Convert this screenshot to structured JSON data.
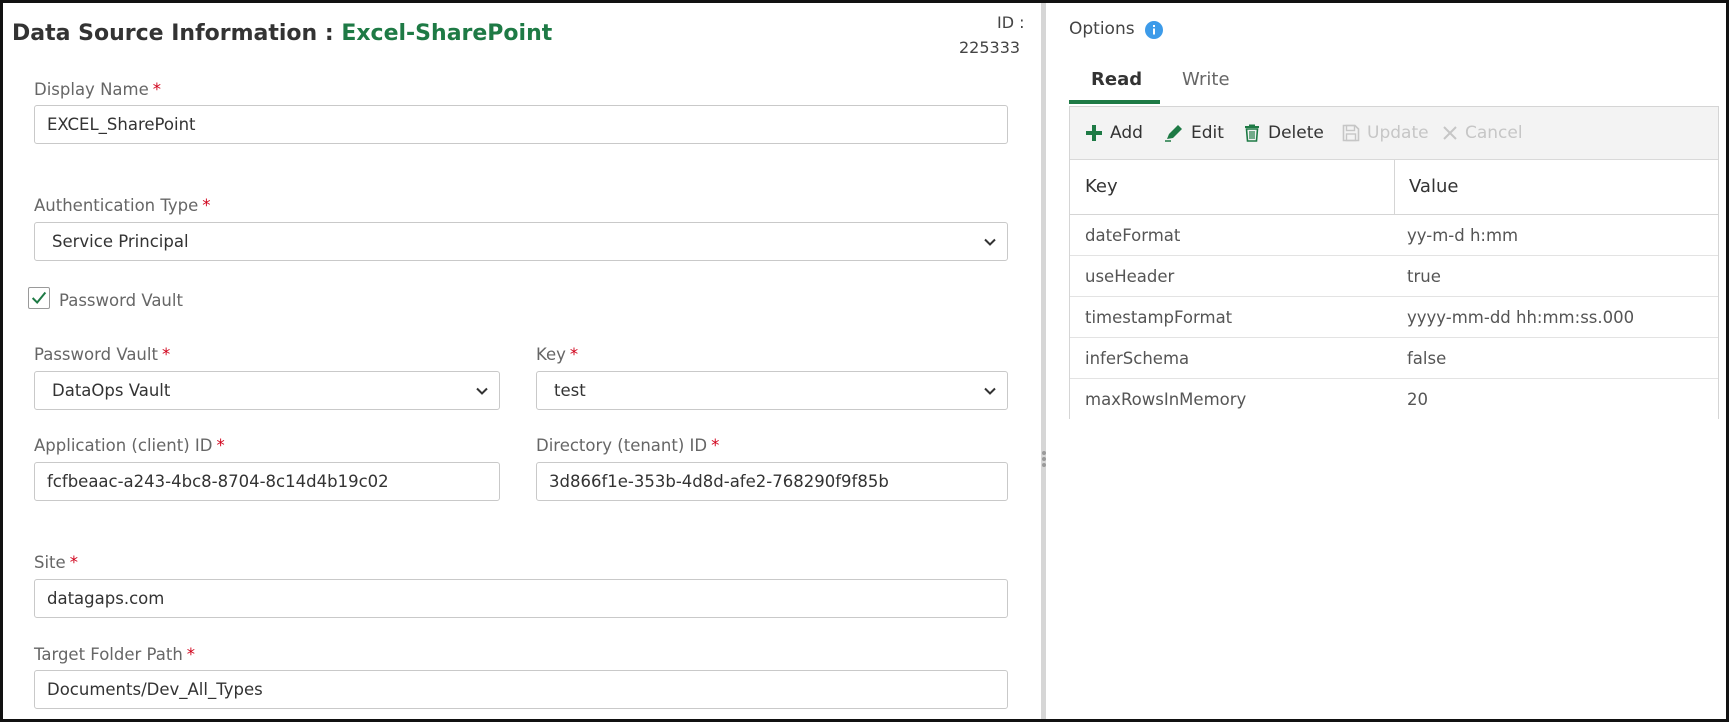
{
  "header": {
    "title_prefix": "Data Source Information : ",
    "title_source": "Excel-SharePoint",
    "id_label": "ID :",
    "id_value": "225333"
  },
  "form": {
    "display_name": {
      "label": "Display Name",
      "value": "EXCEL_SharePoint"
    },
    "auth_type": {
      "label": "Authentication Type",
      "value": "Service Principal"
    },
    "password_vault_checkbox": {
      "label": "Password Vault",
      "checked": true
    },
    "password_vault": {
      "label": "Password Vault",
      "value": "DataOps Vault"
    },
    "key": {
      "label": "Key",
      "value": "test"
    },
    "client_id": {
      "label": "Application (client) ID",
      "value": "fcfbeaac-a243-4bc8-8704-8c14d4b19c02"
    },
    "tenant_id": {
      "label": "Directory (tenant) ID",
      "value": "3d866f1e-353b-4d8d-afe2-768290f9f85b"
    },
    "site": {
      "label": "Site",
      "value": "datagaps.com"
    },
    "target_folder": {
      "label": "Target Folder Path",
      "value": "Documents/Dev_All_Types"
    },
    "required_mark": "*"
  },
  "options": {
    "title": "Options",
    "tabs": [
      {
        "label": "Read",
        "active": true
      },
      {
        "label": "Write",
        "active": false
      }
    ],
    "toolbar": {
      "add": "Add",
      "edit": "Edit",
      "delete": "Delete",
      "update": "Update",
      "cancel": "Cancel"
    },
    "columns": {
      "key": "Key",
      "value": "Value"
    },
    "rows": [
      {
        "key": "dateFormat",
        "value": "yy-m-d h:mm"
      },
      {
        "key": "useHeader",
        "value": "true"
      },
      {
        "key": "timestampFormat",
        "value": "yyyy-mm-dd hh:mm:ss.000"
      },
      {
        "key": "inferSchema",
        "value": "false"
      },
      {
        "key": "maxRowsInMemory",
        "value": "20"
      }
    ]
  },
  "colors": {
    "accent_green": "#1e7a45",
    "required_red": "#d0021b",
    "info_blue": "#3d9be9"
  }
}
